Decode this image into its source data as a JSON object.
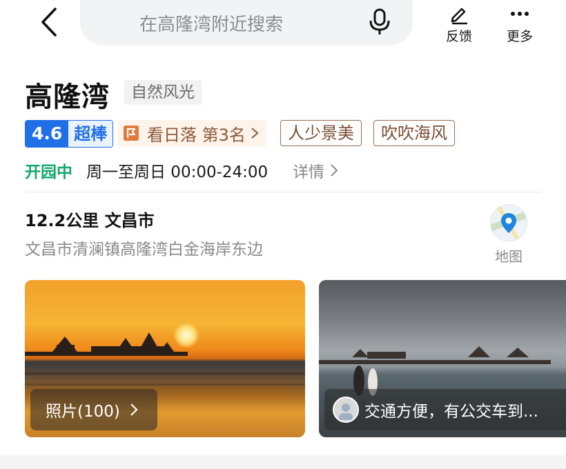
{
  "search": {
    "placeholder": "在高隆湾附近搜索"
  },
  "top_actions": {
    "feedback": "反馈",
    "more": "更多"
  },
  "place": {
    "name": "高隆湾",
    "category": "自然风光",
    "rating_score": "4.6",
    "rating_word": "超棒",
    "rank_label": "看日落 第3名",
    "tags": [
      "人少景美",
      "吹吹海风"
    ],
    "status": "开园中",
    "hours": "周一至周日 00:00-24:00",
    "detail_link": "详情",
    "distance_city": "12.2公里 文昌市",
    "address": "文昌市清澜镇高隆湾白金海岸东边",
    "map_label": "地图"
  },
  "photos": {
    "count_label": "照片(100)",
    "review_snippet": "交通方便，有公交车到..."
  },
  "colors": {
    "accent": "#1f6fe6",
    "open": "#14a86b",
    "tag_brown": "#7a4f33"
  }
}
